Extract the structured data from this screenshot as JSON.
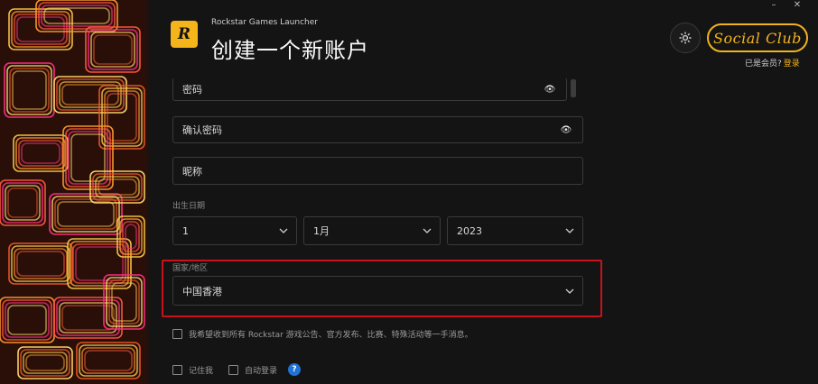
{
  "header": {
    "logo_text": "R",
    "app_title": "Rockstar Games Launcher",
    "page_title": "创建一个新账户",
    "social_club": "Social Club",
    "member_prompt": "已是会员?",
    "login_link": "登录"
  },
  "window": {
    "minimize": "–",
    "close": "✕"
  },
  "form": {
    "password": {
      "placeholder": "密码"
    },
    "confirm_password": {
      "placeholder": "确认密码"
    },
    "nickname": {
      "placeholder": "昵称"
    },
    "birthdate_label": "出生日期",
    "birth_day": "1",
    "birth_month": "1月",
    "birth_year": "2023",
    "country_label": "国家/地区",
    "country": "中国香港",
    "newsletter_label": "我希望收到所有 Rockstar 游戏公告、官方发布、比赛、特殊活动等一手消息。",
    "remember_label": "记住我",
    "auto_login_label": "自动登录",
    "help": "?"
  },
  "colors": {
    "accent": "#f2b21d",
    "highlight": "#c8121b",
    "help": "#1f72d6"
  }
}
